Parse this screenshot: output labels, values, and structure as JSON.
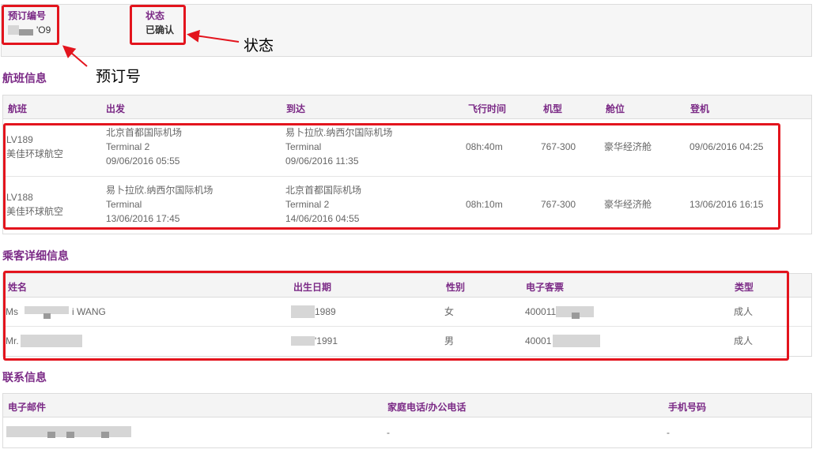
{
  "booking": {
    "ref_label": "预订编号",
    "ref_value": "'O9",
    "status_label": "状态",
    "status_value": "已确认"
  },
  "annotations": {
    "status_note": "状态",
    "ref_note": "预订号"
  },
  "flights": {
    "title": "航班信息",
    "headers": {
      "flight": "航班",
      "depart": "出发",
      "arrive": "到达",
      "duration": "飞行时间",
      "aircraft": "机型",
      "cabin": "舱位",
      "boarding": "登机"
    },
    "rows": [
      {
        "flight_no": "LV189",
        "airline": "美佳环球航空",
        "dep_airport": "北京首都国际机场",
        "dep_terminal": "Terminal 2",
        "dep_time": "09/06/2016 05:55",
        "arr_airport": "易卜拉欣.纳西尔国际机场",
        "arr_terminal": "Terminal",
        "arr_time": "09/06/2016 11:35",
        "duration": "08h:40m",
        "aircraft": "767-300",
        "cabin": "豪华经济舱",
        "boarding": "09/06/2016 04:25"
      },
      {
        "flight_no": "LV188",
        "airline": "美佳环球航空",
        "dep_airport": "易卜拉欣.纳西尔国际机场",
        "dep_terminal": "Terminal",
        "dep_time": "13/06/2016 17:45",
        "arr_airport": "北京首都国际机场",
        "arr_terminal": "Terminal 2",
        "arr_time": "14/06/2016 04:55",
        "duration": "08h:10m",
        "aircraft": "767-300",
        "cabin": "豪华经济舱",
        "boarding": "13/06/2016 16:15"
      }
    ]
  },
  "passengers": {
    "title": "乘客详细信息",
    "headers": {
      "name": "姓名",
      "dob": "出生日期",
      "gender": "性别",
      "ticket": "电子客票",
      "type": "类型"
    },
    "rows": [
      {
        "name_prefix": "Ms",
        "name_suffix": "i WANG",
        "dob": "1989",
        "gender": "女",
        "ticket": "400011",
        "type": "成人"
      },
      {
        "name_prefix": "Mr.",
        "name_suffix": "",
        "dob": "'1991",
        "gender": "男",
        "ticket": "40001",
        "type": "成人"
      }
    ]
  },
  "contact": {
    "title": "联系信息",
    "headers": {
      "email": "电子邮件",
      "home_phone": "家庭电话/办公电话",
      "mobile": "手机号码"
    },
    "row": {
      "home_phone": "-",
      "mobile": "-"
    }
  }
}
